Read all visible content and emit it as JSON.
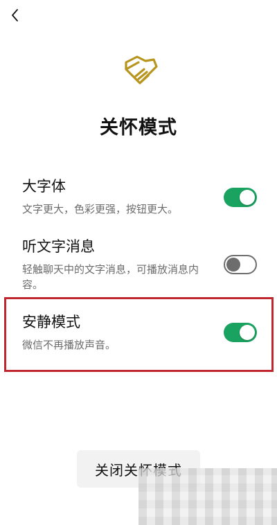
{
  "title": "关怀模式",
  "settings": [
    {
      "label": "大字体",
      "desc": "文字更大，色彩更强，按钮更大。",
      "enabled": true
    },
    {
      "label": "听文字消息",
      "desc": "轻触聊天中的文字消息，可播放消息内容。",
      "enabled": false
    },
    {
      "label": "安静模式",
      "desc": "微信不再播放声音。",
      "enabled": true
    }
  ],
  "close_button": "关闭关怀模式",
  "colors": {
    "toggle_on": "#1aa260",
    "icon_gold": "#b8951e",
    "highlight_border": "#c0262d"
  }
}
